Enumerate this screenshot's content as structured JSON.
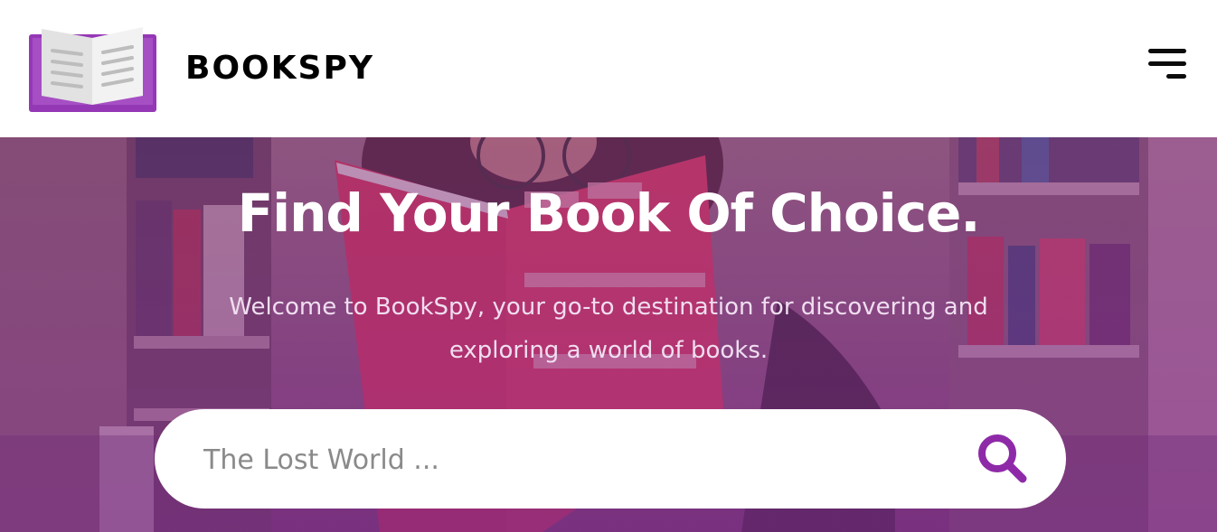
{
  "header": {
    "brand": "BOOKSPY",
    "logo_icon": "open-book-icon",
    "menu_icon": "hamburger-menu-icon"
  },
  "hero": {
    "title": "Find Your Book Of Choice.",
    "subtitle": "Welcome to BookSpy, your go-to destination for discovering and exploring a world of books.",
    "search": {
      "placeholder": "The Lost World ...",
      "value": "",
      "button_icon": "search-icon"
    },
    "background_icon": "reader-with-book-photo"
  },
  "colors": {
    "accent": "#8e2aa8",
    "logo_purple": "#9538b5",
    "hero_overlay": "#7a2f82",
    "text_dark": "#000000",
    "text_light": "#ffffff"
  }
}
